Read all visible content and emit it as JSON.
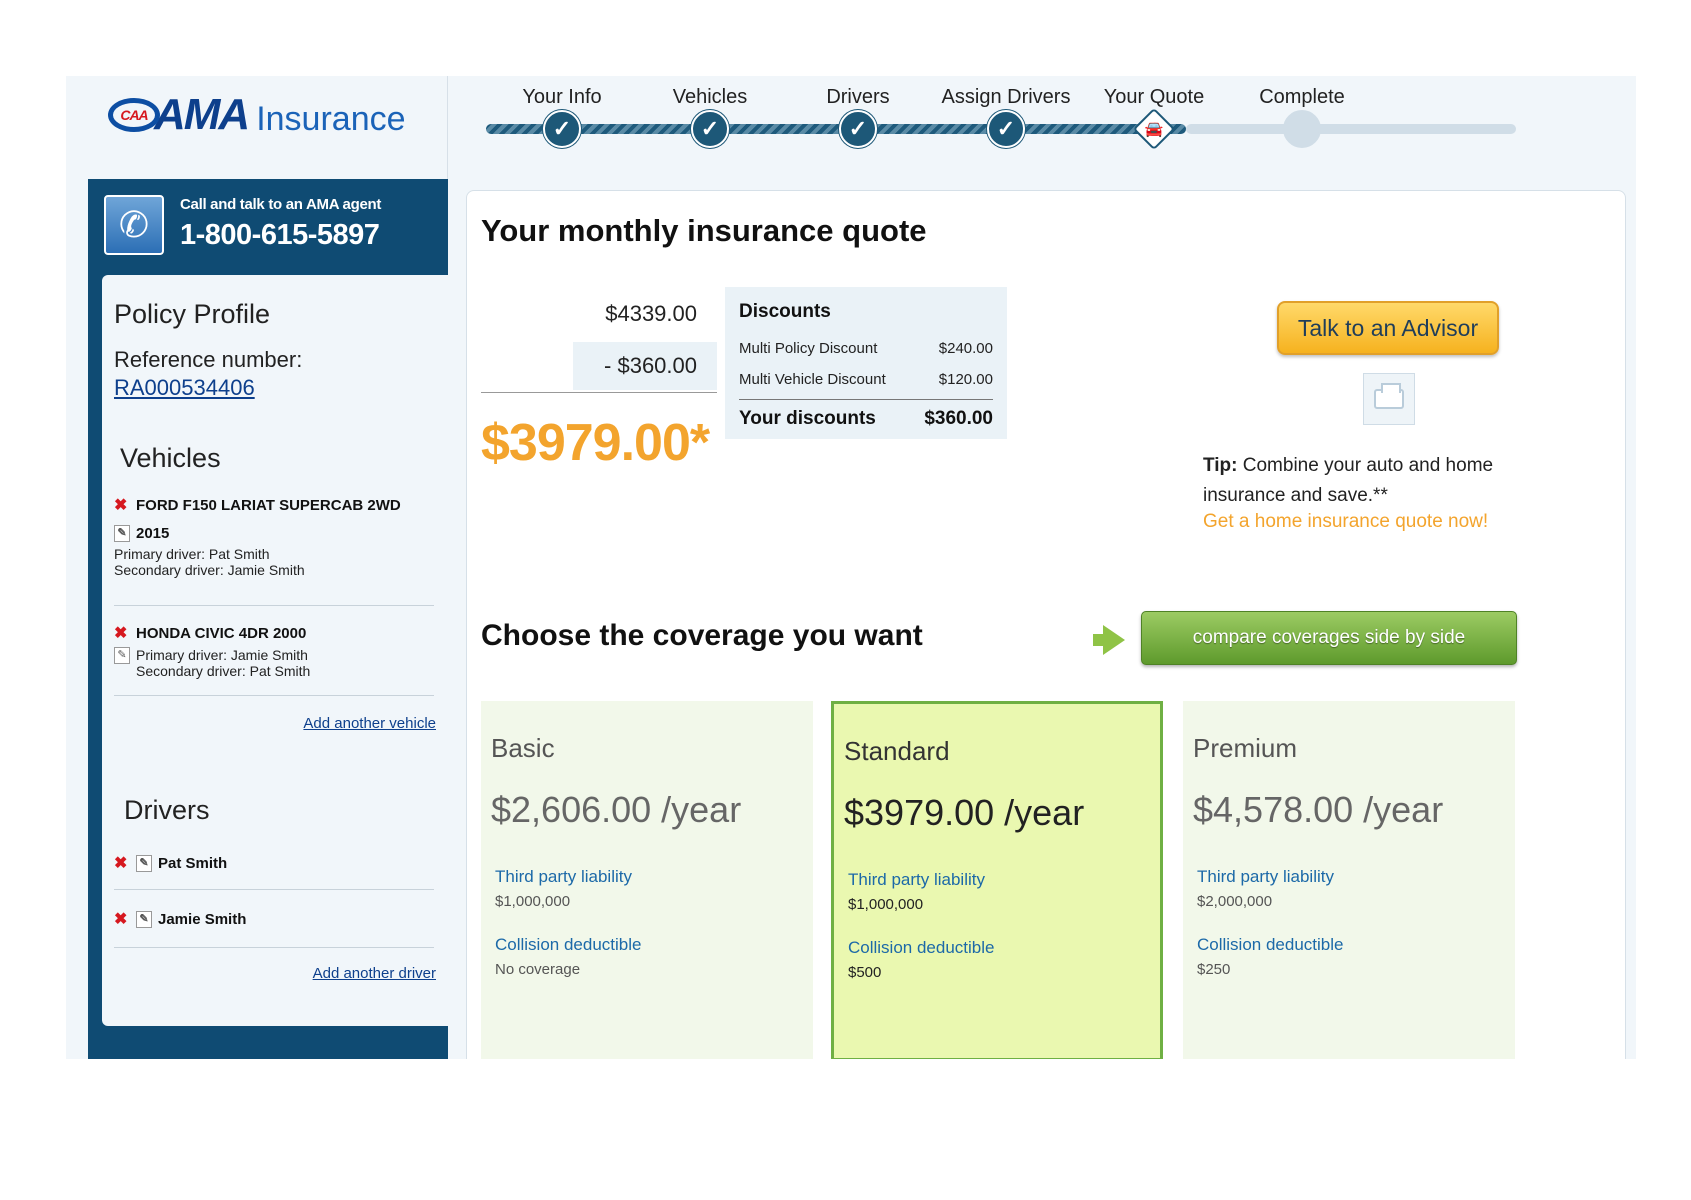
{
  "logo": {
    "badge": "CAA",
    "brand": "AMA",
    "suffix": "Insurance"
  },
  "steps": [
    {
      "label": "Your Info",
      "state": "done"
    },
    {
      "label": "Vehicles",
      "state": "done"
    },
    {
      "label": "Drivers",
      "state": "done"
    },
    {
      "label": "Assign Drivers",
      "state": "done"
    },
    {
      "label": "Your Quote",
      "state": "current"
    },
    {
      "label": "Complete",
      "state": "todo"
    }
  ],
  "call": {
    "line1": "Call and talk to an AMA agent",
    "phone": "1-800-615-5897"
  },
  "policy": {
    "title": "Policy Profile",
    "ref_label": "Reference number:",
    "ref_number": "RA000534406"
  },
  "vehicles": {
    "title": "Vehicles",
    "items": [
      {
        "name": "FORD F150 LARIAT SUPERCAB 2WD",
        "year": "2015",
        "primary": "Primary driver: Pat Smith",
        "secondary": "Secondary driver: Jamie Smith"
      },
      {
        "name": "HONDA CIVIC 4DR 2000",
        "primary": "Primary driver: Jamie Smith",
        "secondary": "Secondary driver: Pat Smith"
      }
    ],
    "add_link": "Add another vehicle"
  },
  "drivers": {
    "title": "Drivers",
    "items": [
      "Pat Smith",
      "Jamie Smith"
    ],
    "add_link": "Add another driver"
  },
  "quote": {
    "title": "Your monthly insurance quote",
    "base": "$4339.00",
    "discount": "- $360.00",
    "total": "$3979.00*",
    "discounts": {
      "head": "Discounts",
      "rows": [
        {
          "label": "Multi Policy Discount",
          "value": "$240.00"
        },
        {
          "label": "Multi Vehicle Discount",
          "value": "$120.00"
        }
      ],
      "total_label": "Your discounts",
      "total_value": "$360.00"
    },
    "advisor_button": "Talk to an Advisor",
    "tip_bold": "Tip:",
    "tip_text": "Combine your auto and home insurance and save.**",
    "tip_link": "Get a home insurance quote now!"
  },
  "coverage": {
    "title": "Choose the coverage you want",
    "compare_button": "compare coverages side by side",
    "plans": [
      {
        "name": "Basic",
        "price": "$2,606.00 /year",
        "liability_label": "Third party liability",
        "liability_value": "$1,000,000",
        "collision_label": "Collision deductible",
        "collision_value": "No coverage"
      },
      {
        "name": "Standard",
        "price": "$3979.00 /year",
        "liability_label": "Third party liability",
        "liability_value": "$1,000,000",
        "collision_label": "Collision deductible",
        "collision_value": "$500",
        "selected": true
      },
      {
        "name": "Premium",
        "price": "$4,578.00 /year",
        "liability_label": "Third party liability",
        "liability_value": "$2,000,000",
        "collision_label": "Collision deductible",
        "collision_value": "$250"
      }
    ]
  },
  "icons": {
    "check": "check-icon",
    "car": "car-icon",
    "remove": "remove-x-icon",
    "edit": "edit-icon",
    "phone": "phone-icon",
    "print": "print-icon",
    "arrow": "arrow-right-icon"
  },
  "colors": {
    "navy": "#0f4b73",
    "accent_orange": "#f3a42d",
    "green": "#6fb043",
    "link_blue": "#1c69a8"
  }
}
